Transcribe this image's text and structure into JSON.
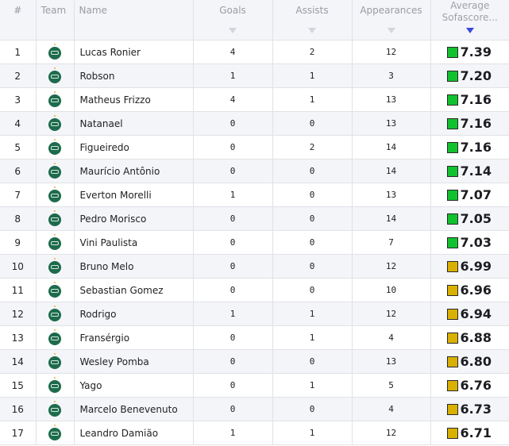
{
  "table": {
    "headers": {
      "rank": "#",
      "team": "Team",
      "name": "Name",
      "goals": "Goals",
      "assists": "Assists",
      "appearances": "Appearances",
      "rating": "Average Sofascore..."
    },
    "sort_column": "rating",
    "colors": {
      "rating_high": "#11c12e",
      "rating_mid": "#d9b000",
      "sort_active": "#3b4bd8",
      "sort_inactive": "#d4d5da"
    },
    "rows": [
      {
        "rank": "1",
        "team_icon": "coritiba-logo",
        "name": "Lucas Ronier",
        "goals": "4",
        "assists": "2",
        "appearances": "12",
        "rating": "7.39",
        "tier": "high"
      },
      {
        "rank": "2",
        "team_icon": "coritiba-logo",
        "name": "Robson",
        "goals": "1",
        "assists": "1",
        "appearances": "3",
        "rating": "7.20",
        "tier": "high"
      },
      {
        "rank": "3",
        "team_icon": "coritiba-logo",
        "name": "Matheus Frizzo",
        "goals": "4",
        "assists": "1",
        "appearances": "13",
        "rating": "7.16",
        "tier": "high"
      },
      {
        "rank": "4",
        "team_icon": "coritiba-logo",
        "name": "Natanael",
        "goals": "0",
        "assists": "0",
        "appearances": "13",
        "rating": "7.16",
        "tier": "high"
      },
      {
        "rank": "5",
        "team_icon": "coritiba-logo",
        "name": "Figueiredo",
        "goals": "0",
        "assists": "2",
        "appearances": "14",
        "rating": "7.16",
        "tier": "high"
      },
      {
        "rank": "6",
        "team_icon": "coritiba-logo",
        "name": "Maurício Antônio",
        "goals": "0",
        "assists": "0",
        "appearances": "14",
        "rating": "7.14",
        "tier": "high"
      },
      {
        "rank": "7",
        "team_icon": "coritiba-logo",
        "name": "Everton Morelli",
        "goals": "1",
        "assists": "0",
        "appearances": "13",
        "rating": "7.07",
        "tier": "high"
      },
      {
        "rank": "8",
        "team_icon": "coritiba-logo",
        "name": "Pedro Morisco",
        "goals": "0",
        "assists": "0",
        "appearances": "14",
        "rating": "7.05",
        "tier": "high"
      },
      {
        "rank": "9",
        "team_icon": "coritiba-logo",
        "name": "Vini Paulista",
        "goals": "0",
        "assists": "0",
        "appearances": "7",
        "rating": "7.03",
        "tier": "high"
      },
      {
        "rank": "10",
        "team_icon": "coritiba-logo",
        "name": "Bruno Melo",
        "goals": "0",
        "assists": "0",
        "appearances": "12",
        "rating": "6.99",
        "tier": "mid"
      },
      {
        "rank": "11",
        "team_icon": "coritiba-logo",
        "name": "Sebastian Gomez",
        "goals": "0",
        "assists": "0",
        "appearances": "10",
        "rating": "6.96",
        "tier": "mid"
      },
      {
        "rank": "12",
        "team_icon": "coritiba-logo",
        "name": "Rodrigo",
        "goals": "1",
        "assists": "1",
        "appearances": "12",
        "rating": "6.94",
        "tier": "mid"
      },
      {
        "rank": "13",
        "team_icon": "coritiba-logo",
        "name": "Fransérgio",
        "goals": "0",
        "assists": "1",
        "appearances": "4",
        "rating": "6.88",
        "tier": "mid"
      },
      {
        "rank": "14",
        "team_icon": "coritiba-logo",
        "name": "Wesley Pomba",
        "goals": "0",
        "assists": "0",
        "appearances": "13",
        "rating": "6.80",
        "tier": "mid"
      },
      {
        "rank": "15",
        "team_icon": "coritiba-logo",
        "name": "Yago",
        "goals": "0",
        "assists": "1",
        "appearances": "5",
        "rating": "6.76",
        "tier": "mid"
      },
      {
        "rank": "16",
        "team_icon": "coritiba-logo",
        "name": "Marcelo Benevenuto",
        "goals": "0",
        "assists": "0",
        "appearances": "4",
        "rating": "6.73",
        "tier": "mid"
      },
      {
        "rank": "17",
        "team_icon": "coritiba-logo",
        "name": "Leandro Damião",
        "goals": "1",
        "assists": "1",
        "appearances": "12",
        "rating": "6.71",
        "tier": "mid"
      }
    ]
  }
}
